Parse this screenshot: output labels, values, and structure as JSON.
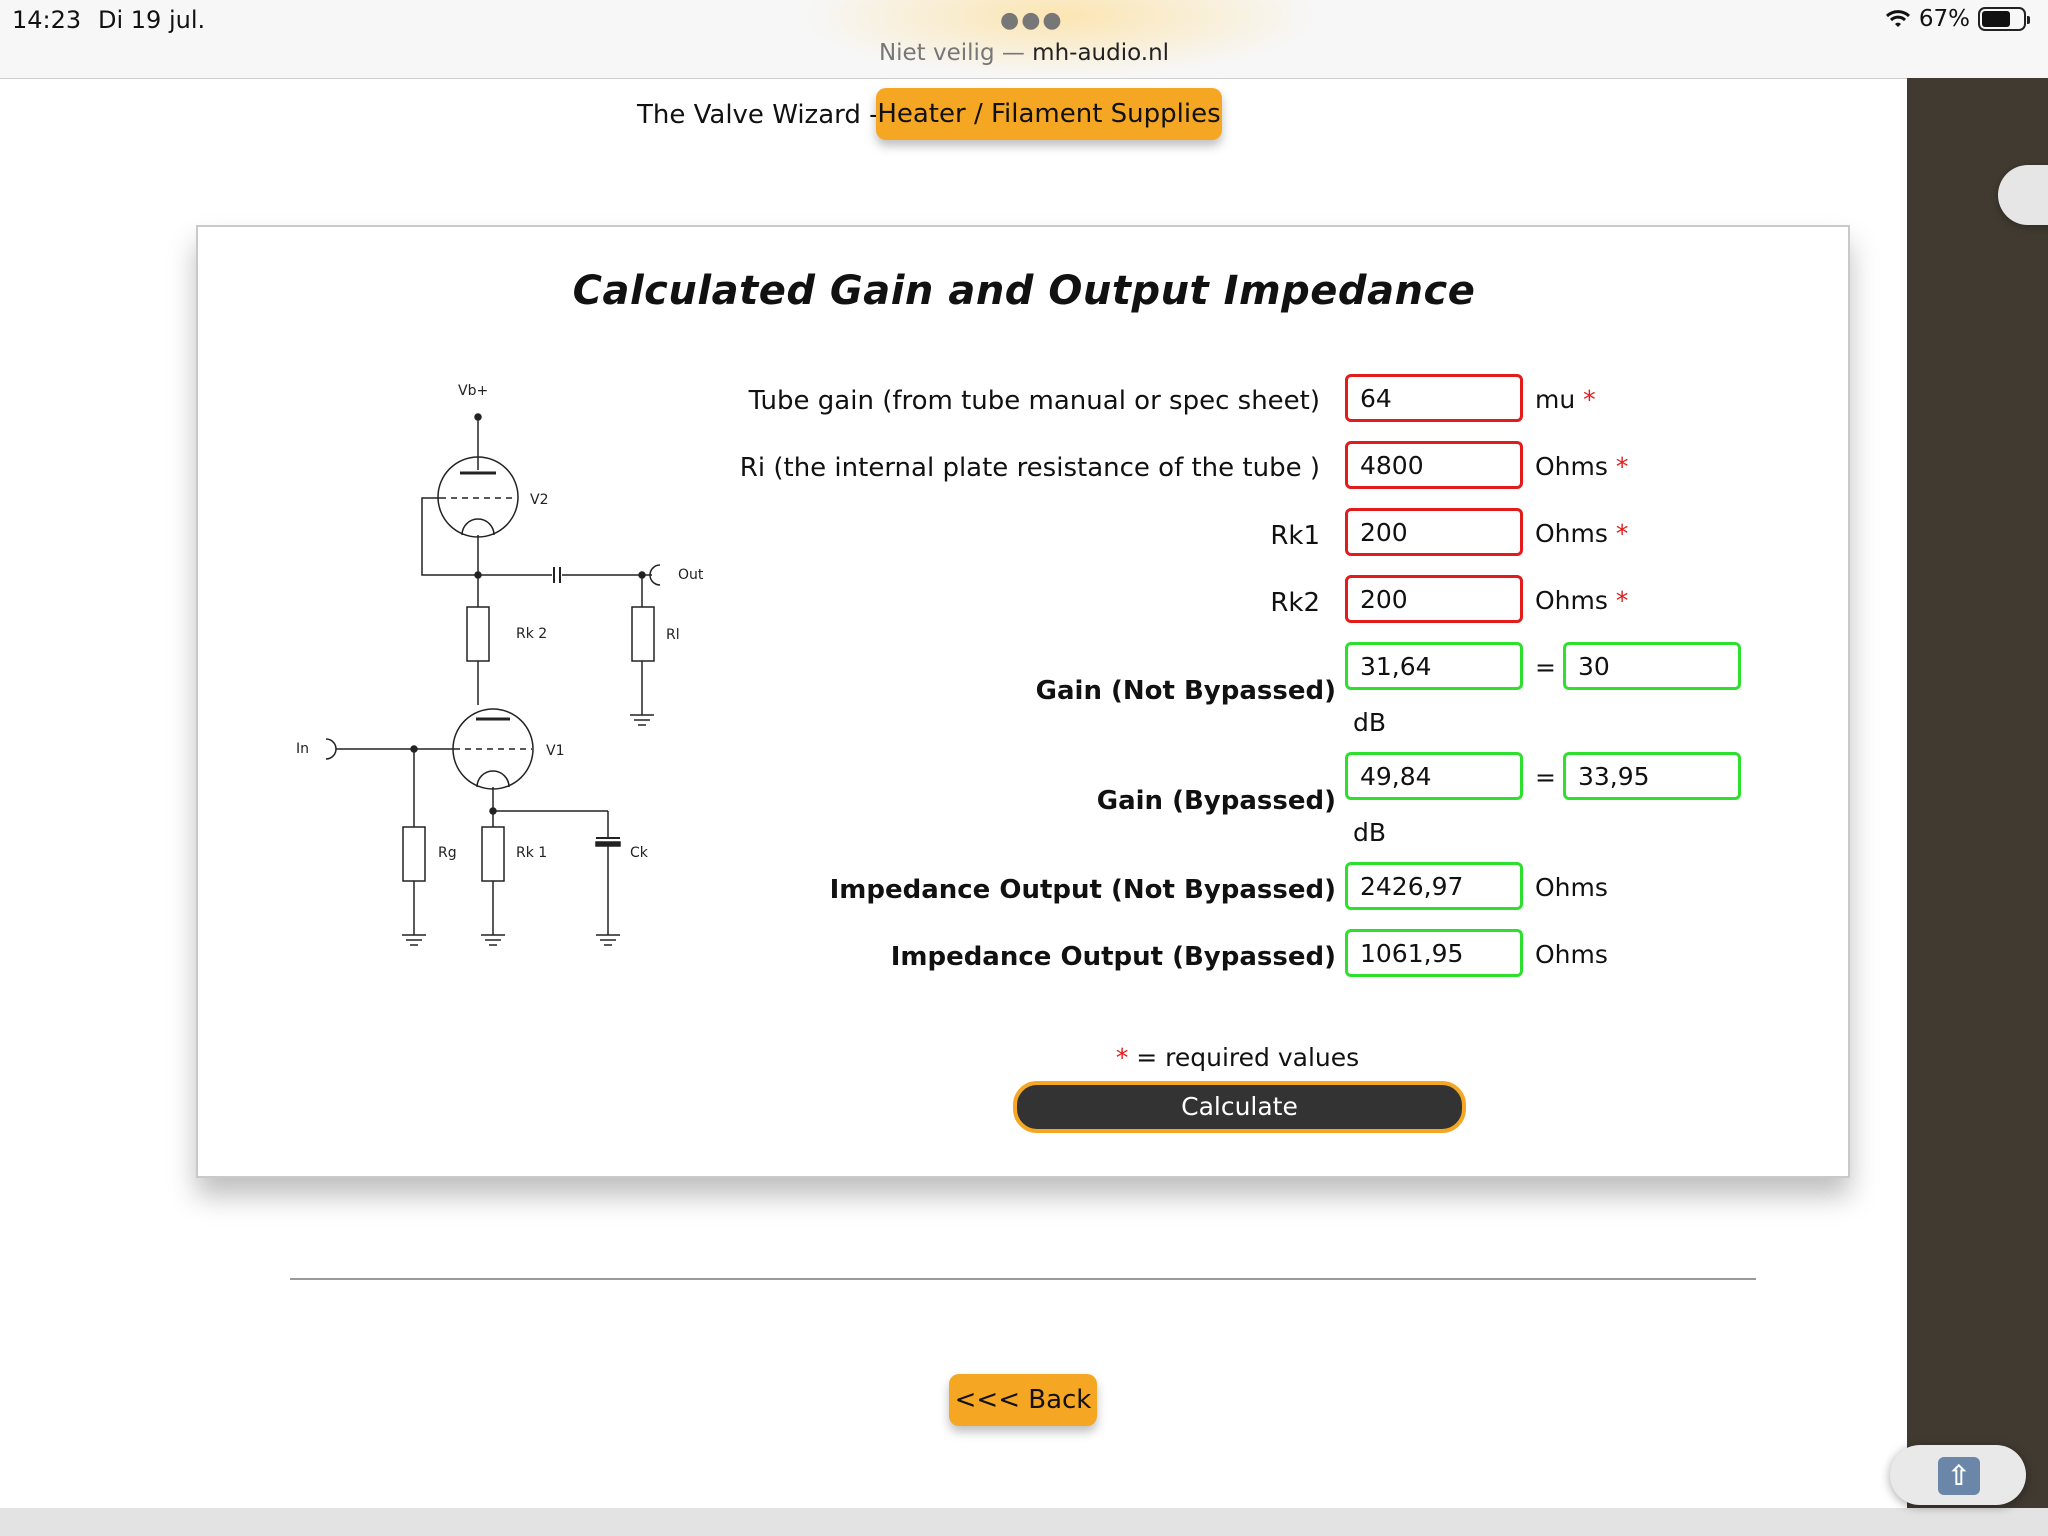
{
  "status": {
    "time": "14:23",
    "date": "Di 19 jul.",
    "url_prefix": "Niet veilig —",
    "url_domain": "mh-audio.nl",
    "battery": "67%"
  },
  "header": {
    "crumb": "The Valve Wizard -",
    "crumb_button": "Heater / Filament Supplies"
  },
  "card": {
    "title": "Calculated Gain and Output Impedance"
  },
  "circuit": {
    "vb": "Vb+",
    "v2": "V2",
    "v1": "V1",
    "out": "Out",
    "rk2": "Rk 2",
    "rl": "Rl",
    "in": "In",
    "rg": "Rg",
    "rk1": "Rk 1",
    "ck": "Ck"
  },
  "form": {
    "tube_gain": {
      "label": "Tube gain (from tube manual or spec sheet)",
      "value": "64",
      "unit": "mu",
      "star": "*"
    },
    "ri": {
      "label": "Ri (the internal plate resistance of the tube )",
      "value": "4800",
      "unit": "Ohms",
      "star": "*"
    },
    "rk1": {
      "label": "Rk1",
      "value": "200",
      "unit": "Ohms",
      "star": "*"
    },
    "rk2": {
      "label": "Rk2",
      "value": "200",
      "unit": "Ohms",
      "star": "*"
    },
    "gain_not_bypassed": {
      "label": "Gain (Not Bypassed)",
      "value": "31,64",
      "eq": "=",
      "db_value": "30",
      "db_unit": "dB"
    },
    "gain_bypassed": {
      "label": "Gain (Bypassed)",
      "value": "49,84",
      "eq": "=",
      "db_value": "33,95",
      "db_unit": "dB"
    },
    "imp_not_bypassed": {
      "label": "Impedance Output (Not Bypassed)",
      "value": "2426,97",
      "unit": "Ohms"
    },
    "imp_bypassed": {
      "label": "Impedance Output (Bypassed)",
      "value": "1061,95",
      "unit": "Ohms"
    },
    "required_star": "*",
    "required_text": "= required values",
    "calculate": "Calculate"
  },
  "nav": {
    "back": "<<< Back"
  }
}
